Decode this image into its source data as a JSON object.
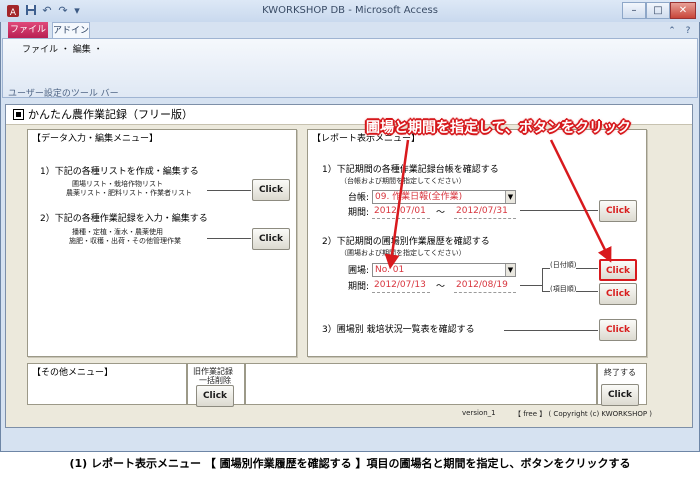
{
  "window": {
    "title": "KWORKSHOP DB - Microsoft Access",
    "minimize": "–",
    "maximize": "□",
    "close": "✕"
  },
  "quick_access": {
    "undo": "↶",
    "redo": "↷",
    "customize": "▾"
  },
  "ribbon": {
    "tabs": [
      "ファイル",
      "アドイン"
    ],
    "menu_items": "ファイル ・ 編集 ・",
    "group_label": "ユーザー設定のツール バー",
    "help_icon": "?",
    "expand_icon": "⌃"
  },
  "form": {
    "title": "かんたん農作業記録（フリー版）",
    "data_panel": {
      "title": "【データ入力・編集メニュー】",
      "item1": "1）下記の各種リストを作成・編集する",
      "item1_sub1": "圃場リスト・栽培作物リスト",
      "item1_sub2": "農薬リスト・肥料リスト・作業者リスト",
      "item2": "2）下記の各種作業記録を入力・編集する",
      "item2_sub1": "播種・定植・潅水・農薬使用",
      "item2_sub2": "施肥・収穫・出荷・その他管理作業",
      "button": "Click"
    },
    "report_panel": {
      "title": "【レポート表示メニュー】",
      "item1": "1）下記期間の各種作業記録台帳を確認する",
      "item1_note": "（台帳および期間を指定してください）",
      "ledger_label": "台帳:",
      "ledger_value": "09. 作業日報(全作業)",
      "period_label": "期間:",
      "period1_from": "2012/07/01",
      "period1_to": "2012/07/31",
      "tilde": "～",
      "item2": "2）下記期間の圃場別作業履歴を確認する",
      "item2_note": "（圃場および期間を指定してください）",
      "field_label": "圃場:",
      "field_value": "No. 01",
      "period2_from": "2012/07/13",
      "period2_to": "2012/08/19",
      "by_date": "(日付順)",
      "by_item": "(項目順)",
      "item3": "3）圃場別 栽培状況一覧表を確認する",
      "button": "Click"
    },
    "other_panel": {
      "title": "【その他メニュー】"
    },
    "old_records": {
      "line1": "旧作業記録",
      "line2": "一括削除",
      "button": "Click"
    },
    "exit": {
      "label": "終了する",
      "button": "Click"
    },
    "version": "version_1",
    "copyright": "【 free 】 ( Copyright (c) KWORKSHOP )"
  },
  "annotation": "圃場と期間を指定して、ボタンをクリック",
  "caption": "(1) レポート表示メニュー 【 圃場別作業履歴を確認する 】項目の圃場名と期間を指定し、ボタンをクリックする",
  "colors": {
    "annotation": "#d8191d",
    "field_text": "#d8353e",
    "file_tab": "#c4245a"
  }
}
